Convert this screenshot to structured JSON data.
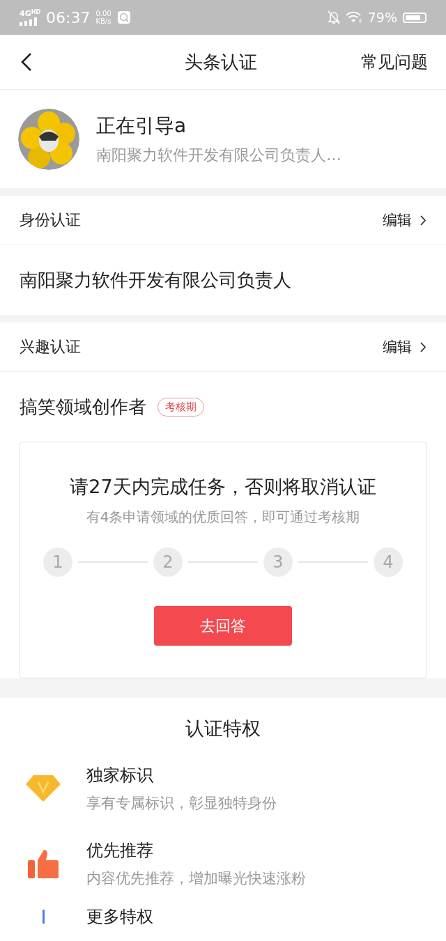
{
  "status_bar": {
    "network": "4G",
    "network_sub": "HD",
    "time": "06:37",
    "speed": "0.00",
    "speed_unit": "KB/s",
    "battery": "79%"
  },
  "nav": {
    "title": "头条认证",
    "action": "常见问题"
  },
  "profile": {
    "name": "正在引导a",
    "subtitle": "南阳聚力软件开发有限公司负责人…"
  },
  "identity": {
    "heading": "身份认证",
    "edit": "编辑",
    "value": "南阳聚力软件开发有限公司负责人"
  },
  "interest": {
    "heading": "兴趣认证",
    "edit": "编辑",
    "value": "搞笑领域创作者",
    "badge": "考核期",
    "task": {
      "title": "请27天内完成任务，否则将取消认证",
      "hint": "有4条申请领域的优质回答，即可通过考核期",
      "steps": [
        {
          "label": "1",
          "done": false
        },
        {
          "label": "2",
          "done": false
        },
        {
          "label": "3",
          "done": false
        },
        {
          "label": "4",
          "done": false
        }
      ],
      "button": "去回答"
    }
  },
  "privileges": {
    "title": "认证特权",
    "items": [
      {
        "kind": "diamond",
        "title": "独家标识",
        "desc": "享有专属标识，彰显独特身份"
      },
      {
        "kind": "thumb",
        "title": "优先推荐",
        "desc": "内容优先推荐，增加曝光快速涨粉"
      },
      {
        "kind": "more",
        "title": "更多特权"
      }
    ]
  }
}
